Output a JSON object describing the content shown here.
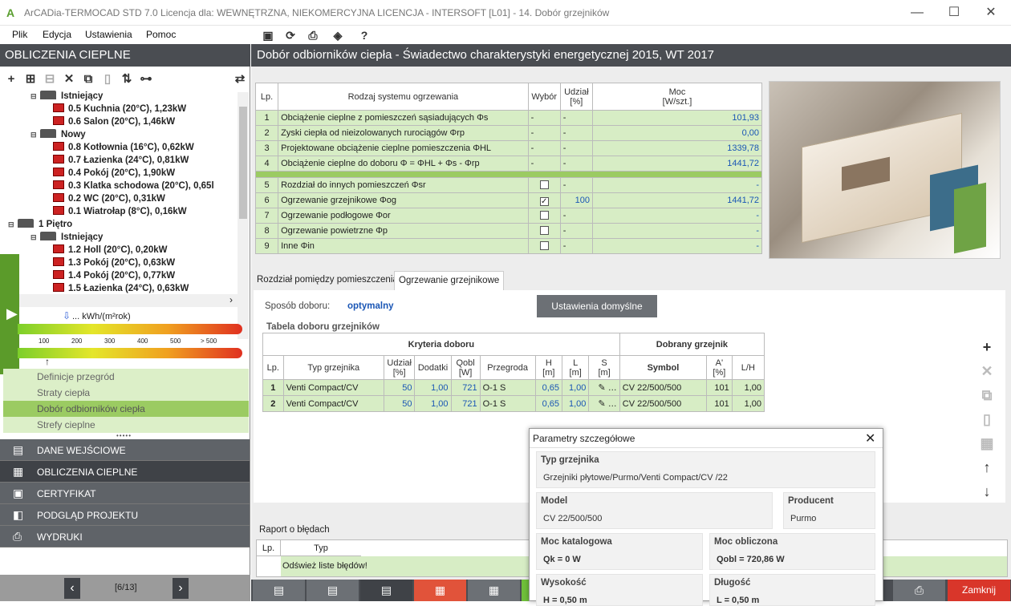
{
  "window": {
    "title": "ArCADia-TERMOCAD STD 7.0 Licencja dla: WEWNĘTRZNA, NIEKOMERCYJNA LICENCJA - INTERSOFT [L01] - 14. Dobór grzejników",
    "minimize": "—",
    "maximize": "☐",
    "close": "✕"
  },
  "menu": [
    "Plik",
    "Edycja",
    "Ustawienia",
    "Pomoc"
  ],
  "left": {
    "header": "OBLICZENIA CIEPLNE",
    "tree": [
      {
        "text": "Istniejący",
        "bold": true,
        "type": "group",
        "indent": 1
      },
      {
        "text": "0.5 Kuchnia (20°C), 1,23kW",
        "bold": true,
        "type": "room",
        "indent": 2
      },
      {
        "text": "0.6 Salon (20°C), 1,46kW",
        "bold": true,
        "type": "room",
        "indent": 2
      },
      {
        "text": "Nowy",
        "bold": true,
        "type": "group",
        "indent": 1
      },
      {
        "text": "0.8 Kotłownia (16°C), 0,62kW",
        "bold": true,
        "type": "room",
        "indent": 2
      },
      {
        "text": "0.7 Łazienka (24°C), 0,81kW",
        "bold": true,
        "type": "room",
        "indent": 2
      },
      {
        "text": "0.4 Pokój (20°C), 1,90kW",
        "bold": true,
        "type": "room",
        "indent": 2
      },
      {
        "text": "0.3 Klatka schodowa (20°C), 0,65l",
        "bold": true,
        "type": "room",
        "indent": 2
      },
      {
        "text": "0.2 WC (20°C), 0,31kW",
        "bold": true,
        "type": "room",
        "indent": 2
      },
      {
        "text": "0.1 Wiatrołap (8°C), 0,16kW",
        "bold": true,
        "type": "room",
        "indent": 2
      },
      {
        "text": "1 Piętro",
        "bold": true,
        "type": "floor",
        "indent": 0
      },
      {
        "text": "Istniejący",
        "bold": true,
        "type": "group",
        "indent": 1
      },
      {
        "text": "1.2 Holl (20°C), 0,20kW",
        "bold": true,
        "type": "room",
        "indent": 2
      },
      {
        "text": "1.3 Pokój (20°C), 0,63kW",
        "bold": true,
        "type": "room",
        "indent": 2
      },
      {
        "text": "1.4 Pokój (20°C), 0,77kW",
        "bold": true,
        "type": "room",
        "indent": 2
      },
      {
        "text": "1.5 Łazienka (24°C), 0,63kW",
        "bold": true,
        "type": "room",
        "indent": 2
      }
    ],
    "energy_label": "... kWh/(m²rok)",
    "energy_ticks": [
      "100",
      "200",
      "300",
      "400",
      "500",
      "> 500"
    ],
    "nav": [
      "Definicje przegród",
      "Straty ciepła",
      "Dobór odbiorników ciepła",
      "Strefy cieplne"
    ],
    "nav_active": 2,
    "dots": "•••••",
    "sections": [
      "DANE WEJŚCIOWE",
      "OBLICZENIA CIEPLNE",
      "CERTYFIKAT",
      "PODGLĄD PROJEKTU",
      "WYDRUKI"
    ],
    "section_active": 1,
    "pager": "[6/13]"
  },
  "main": {
    "header": "Dobór odbiorników ciepła - Świadectwo charakterystyki energetycznej 2015, WT 2017",
    "table1": {
      "headers": [
        "Lp.",
        "Rodzaj systemu ogrzewania",
        "Wybór",
        "Udział\n[%]",
        "Moc\n[W/szt.]"
      ],
      "rows": [
        [
          "1",
          "Obciążenie cieplne z pomieszczeń sąsiadujących Φs",
          "-",
          "-",
          "101,93"
        ],
        [
          "2",
          "Zyski ciepła od nieizolowanych rurociągów Φrp",
          "-",
          "-",
          "0,00"
        ],
        [
          "3",
          "Projektowane obciążenie cieplne pomieszczenia ΦHL",
          "-",
          "-",
          "1339,78"
        ],
        [
          "4",
          "Obciążenie cieplne do doboru Φ = ΦHL + Φs - Φrp",
          "-",
          "-",
          "1441,72"
        ],
        [
          "5",
          "Rozdział do innych pomieszczeń Φsr",
          "",
          "-",
          "-"
        ],
        [
          "6",
          "Ogrzewanie grzejnikowe Φog",
          "",
          "100",
          "1441,72"
        ],
        [
          "7",
          "Ogrzewanie podłogowe Φor",
          "",
          "-",
          "-"
        ],
        [
          "8",
          "Ogrzewanie powietrzne Φp",
          "",
          "-",
          "-"
        ],
        [
          "9",
          "Inne Φin",
          "",
          "-",
          "-"
        ]
      ]
    },
    "tabs": [
      "Rozdział pomiędzy pomieszczeniami",
      "Ogrzewanie grzejnikowe"
    ],
    "tab_active": 1,
    "sposob_label": "Sposób doboru:",
    "sposob_value": "optymalny",
    "defaults_button": "Ustawienia domyślne",
    "tabela_title": "Tabela doboru grzejników",
    "kryteria": "Kryteria doboru",
    "dobrany": "Dobrany grzejnik",
    "table2_headers": [
      "Lp.",
      "Typ grzejnika",
      "Udział\n[%]",
      "Dodatki",
      "Qobl\n[W]",
      "Przegroda",
      "H\n[m]",
      "L\n[m]",
      "S\n[m]",
      "Symbol",
      "A'\n[%]",
      "L/H"
    ],
    "table2_rows": [
      [
        "1",
        "Venti Compact/CV",
        "50",
        "1,00",
        "721",
        "O-1 S",
        "0,65",
        "1,00",
        "CV 22/500/500",
        "101",
        "1,00"
      ],
      [
        "2",
        "Venti Compact/CV",
        "50",
        "1,00",
        "721",
        "O-1 S",
        "0,65",
        "1,00",
        "CV 22/500/500",
        "101",
        "1,00"
      ]
    ],
    "raport_title": "Raport o błędach",
    "raport_headers": [
      "Lp.",
      "Typ"
    ],
    "raport_msg": "Odśwież liste błędów!",
    "close_button": "Zamknij"
  },
  "popup": {
    "title": "Parametry szczegółowe",
    "typ_label": "Typ grzejnika",
    "typ_value": "Grzejniki płytowe/Purmo/Venti Compact/CV /22",
    "model_label": "Model",
    "model_value": "CV 22/500/500",
    "producent_label": "Producent",
    "producent_value": "Purmo",
    "moc_kat_label": "Moc katalogowa",
    "moc_kat_value": "Qk = 0 W",
    "moc_obl_label": "Moc obliczona",
    "moc_obl_value": "Qobl = 720,86 W",
    "wys_label": "Wysokość",
    "wys_value": "H = 0,50 m",
    "dl_label": "Długość",
    "dl_value": "L = 0,50 m"
  }
}
